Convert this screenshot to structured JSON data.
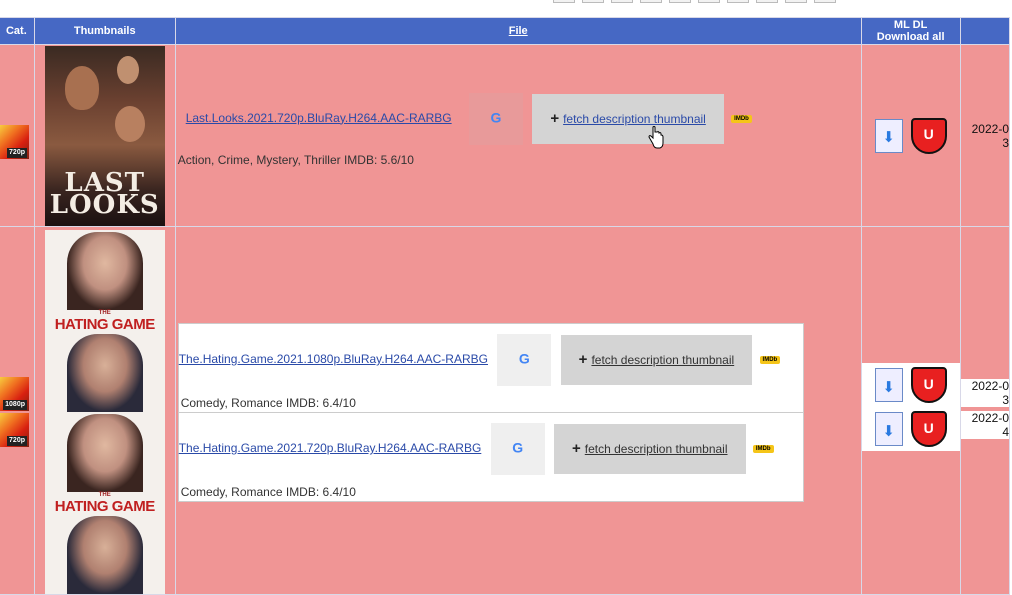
{
  "header": {
    "cat": "Cat.",
    "thumbnails": "Thumbnails",
    "file": "File",
    "mldl_line1": "ML DL",
    "mldl_line2": "Download all"
  },
  "rows": [
    {
      "category": "720p",
      "file_name": "Last.Looks.2021.720p.BluRay.H264.AAC-RARBG",
      "genre": "Action, Crime, Mystery, Thriller IMDB: 5.6/10",
      "fetch_label": "fetch description thumbnail",
      "imdb": "IMDb",
      "poster_title": "LAST LOOKS",
      "date_line1": "2022-0",
      "date_line2": "3"
    },
    {
      "category": "1080p",
      "file_name": "The.Hating.Game.2021.1080p.BluRay.H264.AAC-RARBG",
      "genre": "Comedy, Romance IMDB: 6.4/10",
      "fetch_label": "fetch description thumbnail",
      "imdb": "IMDb",
      "poster_the": "THE",
      "poster_title": "HATING GAME",
      "date_line1": "2022-0",
      "date_line2": "3"
    },
    {
      "category": "720p",
      "file_name": "The.Hating.Game.2021.720p.BluRay.H264.AAC-RARBG",
      "genre": "Comedy, Romance IMDB: 6.4/10",
      "fetch_label": "fetch description thumbnail",
      "imdb": "IMDb",
      "poster_the": "THE",
      "poster_title": "HATING GAME",
      "date_line1": "2022-0",
      "date_line2": "4"
    }
  ],
  "icons": {
    "google": "G",
    "download_arrow": "⬇",
    "magnet": "U"
  },
  "colors": {
    "header_bg": "#4668c4",
    "row_bg": "#f09595",
    "link": "#2a4aa8",
    "imdb": "#f5c518"
  }
}
